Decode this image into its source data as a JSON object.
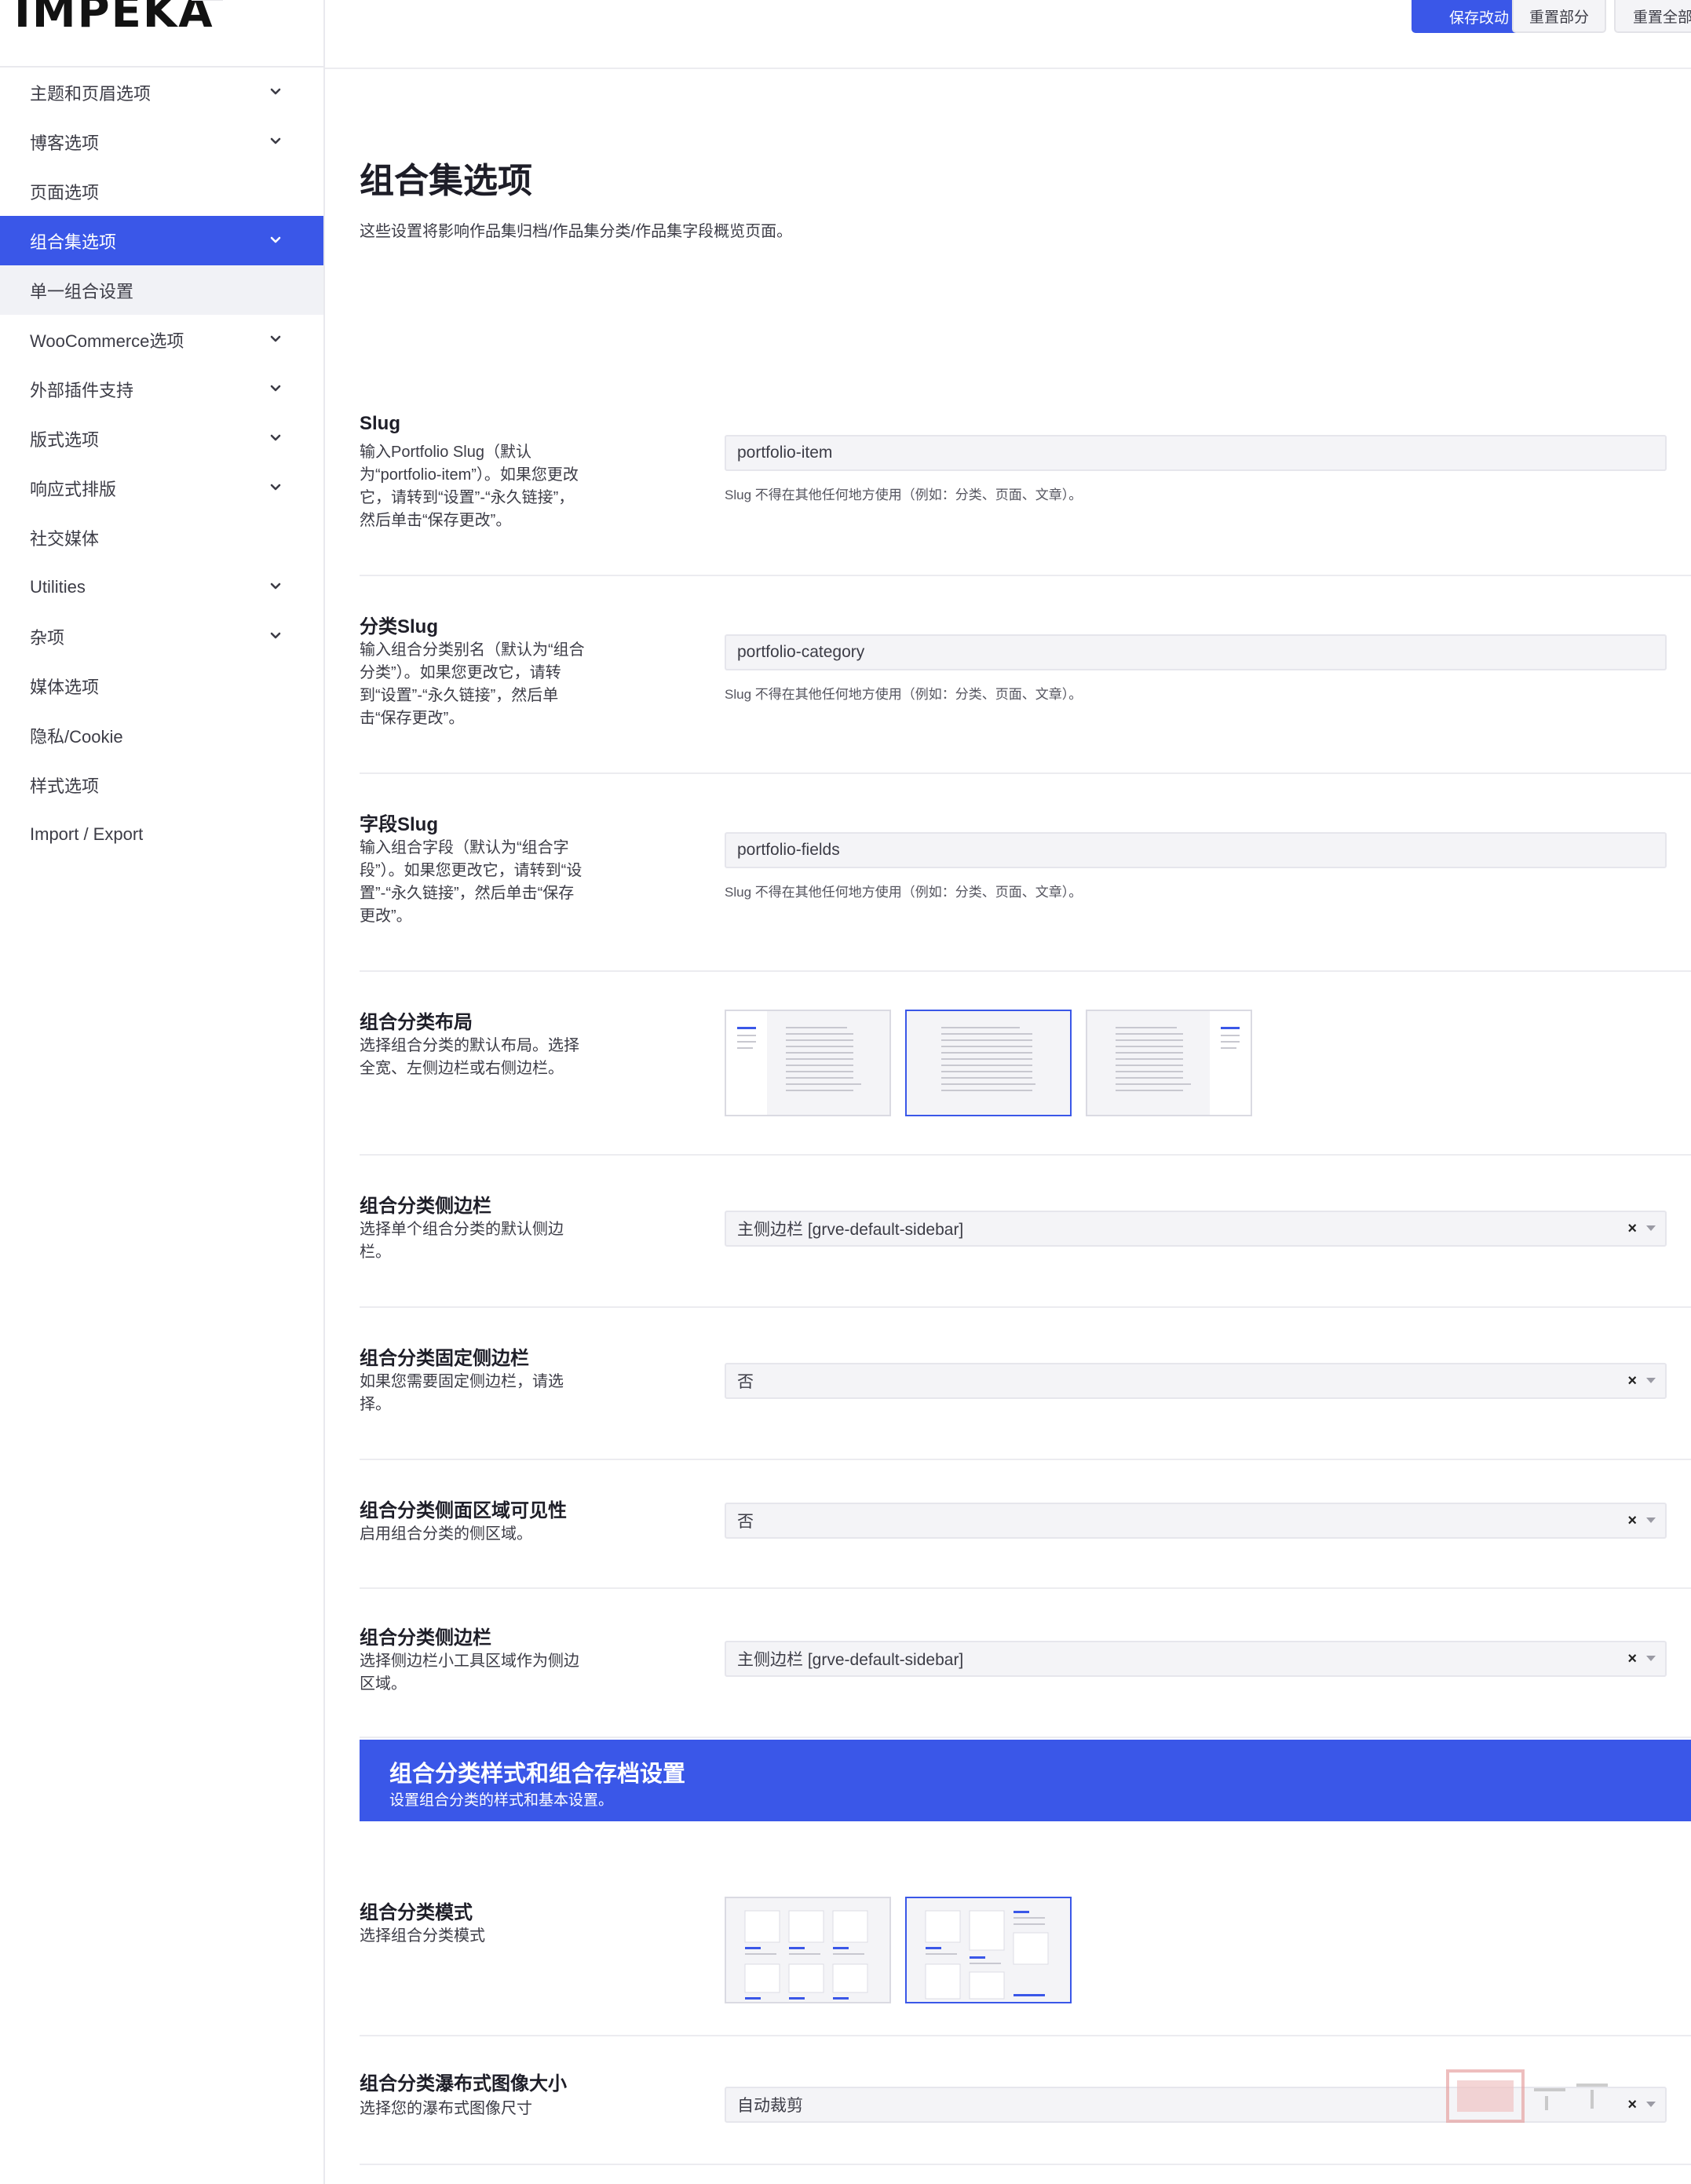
{
  "logo": {
    "text": "IMPEKA"
  },
  "toolbar": {
    "save": "保存改动",
    "reset_section": "重置部分",
    "reset_all": "重置全部"
  },
  "sidebar": {
    "items": [
      {
        "label": "主题和页眉选项",
        "chevron": true
      },
      {
        "label": "博客选项",
        "chevron": true
      },
      {
        "label": "页面选项",
        "chevron": false
      },
      {
        "label": "组合集选项",
        "chevron": true,
        "active": true
      },
      {
        "label": "单一组合设置",
        "chevron": false,
        "sub": true
      },
      {
        "label": "WooCommerce选项",
        "chevron": true
      },
      {
        "label": "外部插件支持",
        "chevron": true
      },
      {
        "label": "版式选项",
        "chevron": true
      },
      {
        "label": "响应式排版",
        "chevron": true
      },
      {
        "label": "社交媒体",
        "chevron": false
      },
      {
        "label": "Utilities",
        "chevron": true
      },
      {
        "label": "杂项",
        "chevron": true
      },
      {
        "label": "媒体选项",
        "chevron": false
      },
      {
        "label": "隐私/Cookie",
        "chevron": false
      },
      {
        "label": "样式选项",
        "chevron": false
      },
      {
        "label": "Import / Export",
        "chevron": false
      }
    ]
  },
  "page": {
    "title": "组合集选项",
    "description": "这些设置将影响作品集归档/作品集分类/作品集字段概览页面。"
  },
  "slug": {
    "label": "Slug",
    "help": "输入Portfolio Slug（默认为“portfolio-item”）。如果您更改它，请转到“设置”-“永久链接”，然后单击“保存更改”。",
    "value": "portfolio-item",
    "note": "Slug 不得在其他任何地方使用（例如：分类、页面、文章）。"
  },
  "category_slug": {
    "label": "分类Slug",
    "help": "输入组合分类别名（默认为“组合分类”）。如果您更改它，请转到“设置”-“永久链接”，然后单击“保存更改”。",
    "value": "portfolio-category",
    "note": "Slug 不得在其他任何地方使用（例如：分类、页面、文章）。"
  },
  "field_slug": {
    "label": "字段Slug",
    "help": "输入组合字段（默认为“组合字段”）。如果您更改它，请转到“设置”-“永久链接”，然后单击“保存更改”。",
    "value": "portfolio-fields",
    "note": "Slug 不得在其他任何地方使用（例如：分类、页面、文章）。"
  },
  "category_layout": {
    "label": "组合分类布局",
    "help": "选择组合分类的默认布局。选择全宽、左侧边栏或右侧边栏。",
    "options": [
      "left-sidebar",
      "full-width",
      "right-sidebar"
    ],
    "selected": "full-width"
  },
  "category_sidebar": {
    "label": "组合分类侧边栏",
    "help": "选择单个组合分类的默认侧边栏。",
    "value": "主侧边栏 [grve-default-sidebar]"
  },
  "fixed_sidebar": {
    "label": "组合分类固定侧边栏",
    "help": "如果您需要固定侧边栏，请选择。",
    "value": "否"
  },
  "side_area": {
    "label": "组合分类侧面区域可见性",
    "help": "启用组合分类的侧区域。",
    "value": "否"
  },
  "side_area_sidebar": {
    "label": "组合分类侧边栏",
    "help": "选择侧边栏小工具区域作为侧边区域。",
    "value": "主侧边栏 [grve-default-sidebar]"
  },
  "section": {
    "title": "组合分类样式和组合存档设置",
    "subtitle": "设置组合分类的样式和基本设置。"
  },
  "category_mode": {
    "label": "组合分类模式",
    "help": "选择组合分类模式",
    "options": [
      "grid",
      "masonry"
    ],
    "selected": "masonry"
  },
  "masonry_image_size": {
    "label": "组合分类瀑布式图像大小",
    "help": "选择您的瀑布式图像尺寸",
    "value": "自动裁剪"
  },
  "colors": {
    "accent": "#3a57e8",
    "field_bg": "#f4f4f7",
    "border": "#ececf0"
  }
}
